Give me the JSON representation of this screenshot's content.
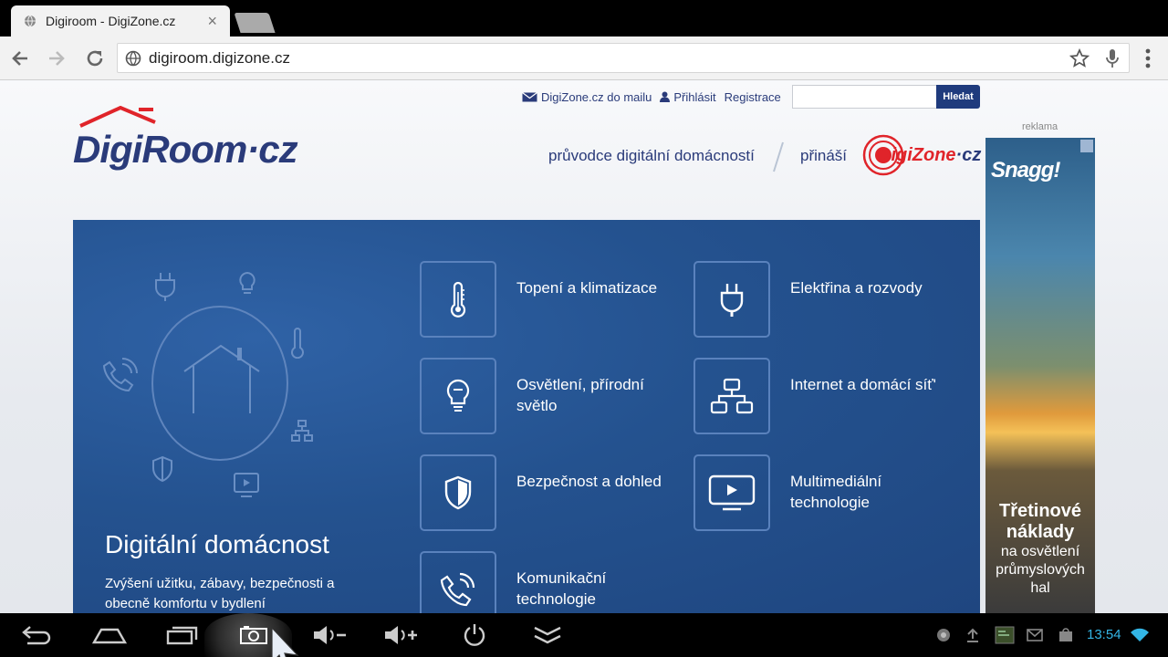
{
  "browser": {
    "tab_title": "Digiroom - DigiZone.cz",
    "tab_close": "×",
    "url": "digiroom.digizone.cz"
  },
  "header": {
    "logo_main": "DigiRoom",
    "logo_suffix": "·cz",
    "links": {
      "mail": "DigiZone.cz do mailu",
      "login": "Přihlásit",
      "register": "Registrace"
    },
    "search": {
      "value": "",
      "button": "Hledat"
    },
    "tagline": "průvodce digitální domácností",
    "brings": "přináší",
    "partner_logo": {
      "main": "DigiZone",
      "suffix": "·cz"
    }
  },
  "ad": {
    "label": "reklama",
    "brand": "Snagg!",
    "headline": "Třetinové náklady",
    "subline": "na osvětlení průmyslových hal"
  },
  "hero": {
    "title": "Digitální domácnost",
    "description": "Zvýšení užitku, zábavy, bezpečnosti a obecně komfortu v bydlení"
  },
  "categories": [
    {
      "label": "Topení a klimatizace",
      "icon": "thermometer-icon"
    },
    {
      "label": "Elektřina a rozvody",
      "icon": "plug-icon"
    },
    {
      "label": "Osvětlení, přírodní světlo",
      "icon": "lightbulb-icon"
    },
    {
      "label": "Internet a domácí síť'",
      "icon": "network-icon"
    },
    {
      "label": "Bezpečnost a dohled",
      "icon": "shield-icon"
    },
    {
      "label": "Multimediální technologie",
      "icon": "monitor-play-icon"
    },
    {
      "label": "Komunikační technologie",
      "icon": "phone-icon"
    }
  ],
  "system": {
    "clock": "13:54",
    "accent": "#33b5e5"
  },
  "colors": {
    "brand_navy": "#2a3b7a",
    "brand_red": "#e0242a",
    "hero_blue": "#24528f"
  }
}
